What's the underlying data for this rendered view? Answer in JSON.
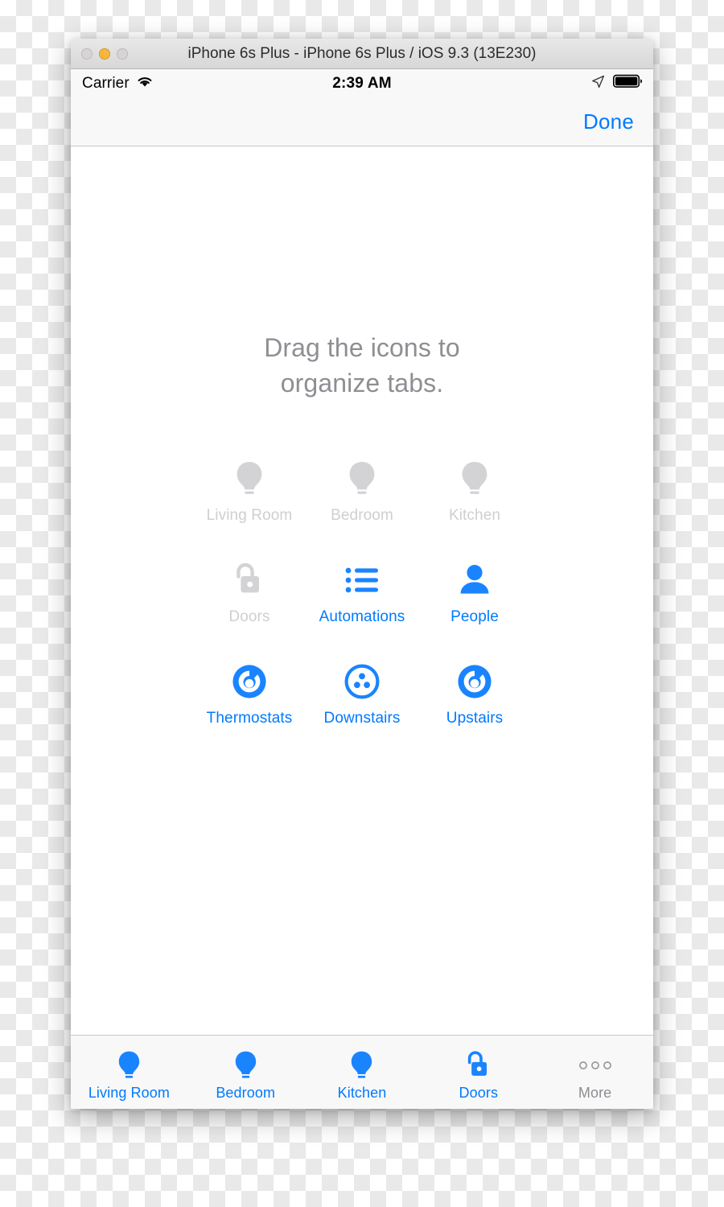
{
  "window": {
    "title": "iPhone 6s Plus - iPhone 6s Plus / iOS 9.3 (13E230)",
    "traffic_lights": [
      {
        "name": "close",
        "color": "#d6d5d4",
        "enabled": false
      },
      {
        "name": "minimize",
        "color": "#f7b73c",
        "enabled": true
      },
      {
        "name": "zoom",
        "color": "#d6d5d4",
        "enabled": false
      }
    ]
  },
  "status_bar": {
    "carrier": "Carrier",
    "wifi_icon": "wifi-icon",
    "time": "2:39 AM",
    "location_icon": "location-arrow-icon",
    "battery_icon": "battery-full-icon"
  },
  "nav_bar": {
    "done_label": "Done"
  },
  "content": {
    "instructions_line1": "Drag the icons to",
    "instructions_line2": "organize tabs.",
    "grid": [
      [
        {
          "label": "Living Room",
          "icon": "lightbulb-icon",
          "state": "placed"
        },
        {
          "label": "Bedroom",
          "icon": "lightbulb-icon",
          "state": "placed"
        },
        {
          "label": "Kitchen",
          "icon": "lightbulb-icon",
          "state": "placed"
        }
      ],
      [
        {
          "label": "Doors",
          "icon": "unlocked-padlock-icon",
          "state": "placed"
        },
        {
          "label": "Automations",
          "icon": "bulleted-list-icon",
          "state": "available"
        },
        {
          "label": "People",
          "icon": "person-icon",
          "state": "available"
        }
      ],
      [
        {
          "label": "Thermostats",
          "icon": "thermostat-dial-icon",
          "state": "available"
        },
        {
          "label": "Downstairs",
          "icon": "three-dots-circle-icon",
          "state": "available"
        },
        {
          "label": "Upstairs",
          "icon": "thermostat-dial-icon",
          "state": "available"
        }
      ]
    ]
  },
  "tab_bar": {
    "items": [
      {
        "label": "Living Room",
        "icon": "lightbulb-icon",
        "selected": true
      },
      {
        "label": "Bedroom",
        "icon": "lightbulb-icon",
        "selected": true
      },
      {
        "label": "Kitchen",
        "icon": "lightbulb-icon",
        "selected": true
      },
      {
        "label": "Doors",
        "icon": "unlocked-padlock-icon",
        "selected": true
      },
      {
        "label": "More",
        "icon": "more-dots-icon",
        "selected": false
      }
    ]
  },
  "colors": {
    "ios_blue": "#007aff",
    "icon_blue": "#1a84ff",
    "placed_gray": "#d3d3d5",
    "label_gray": "#8e8e93",
    "minimize_amber": "#f7b73c"
  }
}
